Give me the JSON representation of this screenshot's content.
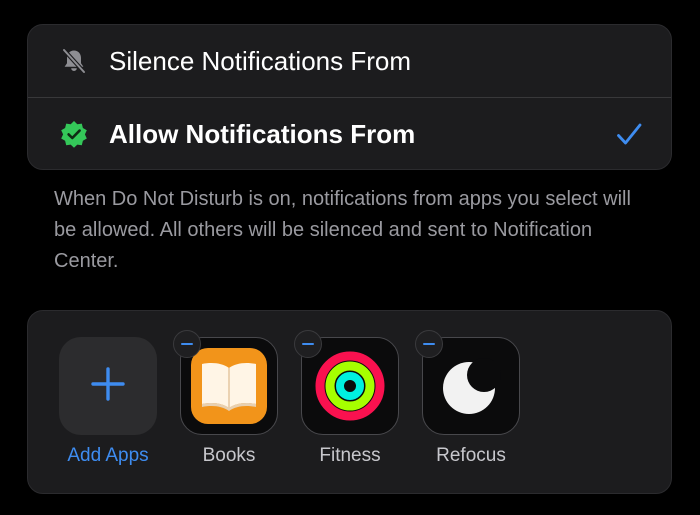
{
  "colors": {
    "accent": "#3e8cf0",
    "background": "#000000",
    "card": "#1c1c1e",
    "secondary_text": "#9a9aa0",
    "verified_green": "#34c759"
  },
  "mode_options": [
    {
      "label": "Silence Notifications From",
      "icon": "bell-slash-icon",
      "selected": false
    },
    {
      "label": "Allow Notifications From",
      "icon": "checkmark-seal-icon",
      "selected": true
    }
  ],
  "selected_indicator_icon": "checkmark-icon",
  "description": "When Do Not Disturb is on, notifications from apps you select will be allowed. All others will be silenced and sent to Notification Center.",
  "apps_section": {
    "add_label": "Add Apps",
    "add_icon": "plus-icon",
    "remove_icon": "minus-icon",
    "apps": [
      {
        "label": "Books",
        "icon": "books-app-icon"
      },
      {
        "label": "Fitness",
        "icon": "fitness-app-icon"
      },
      {
        "label": "Refocus",
        "icon": "refocus-app-icon"
      }
    ]
  }
}
